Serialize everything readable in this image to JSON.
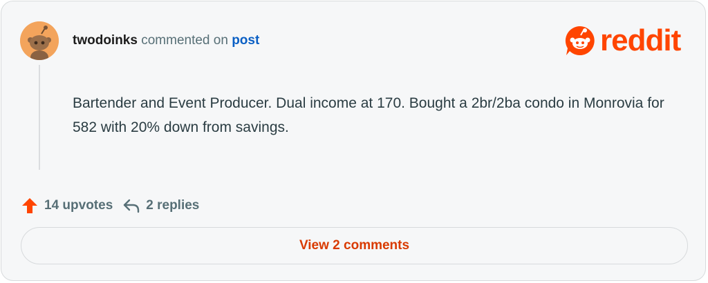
{
  "comment": {
    "username": "twodoinks",
    "action_text": "commented on",
    "target_link": "post",
    "body": "Bartender and Event Producer. Dual income at 170. Bought a 2br/2ba condo in Monrovia for 582 with 20% down from savings."
  },
  "brand": {
    "logo_text": "reddit",
    "color": "#ff4500"
  },
  "actions": {
    "upvotes": "14 upvotes",
    "replies": "2 replies"
  },
  "footer": {
    "view_comments_label": "View 2 comments"
  },
  "icons": {
    "avatar": "snoo-avatar-icon",
    "logo": "reddit-snoo-icon",
    "upvote": "upvote-arrow-icon",
    "reply": "reply-arrow-icon"
  }
}
